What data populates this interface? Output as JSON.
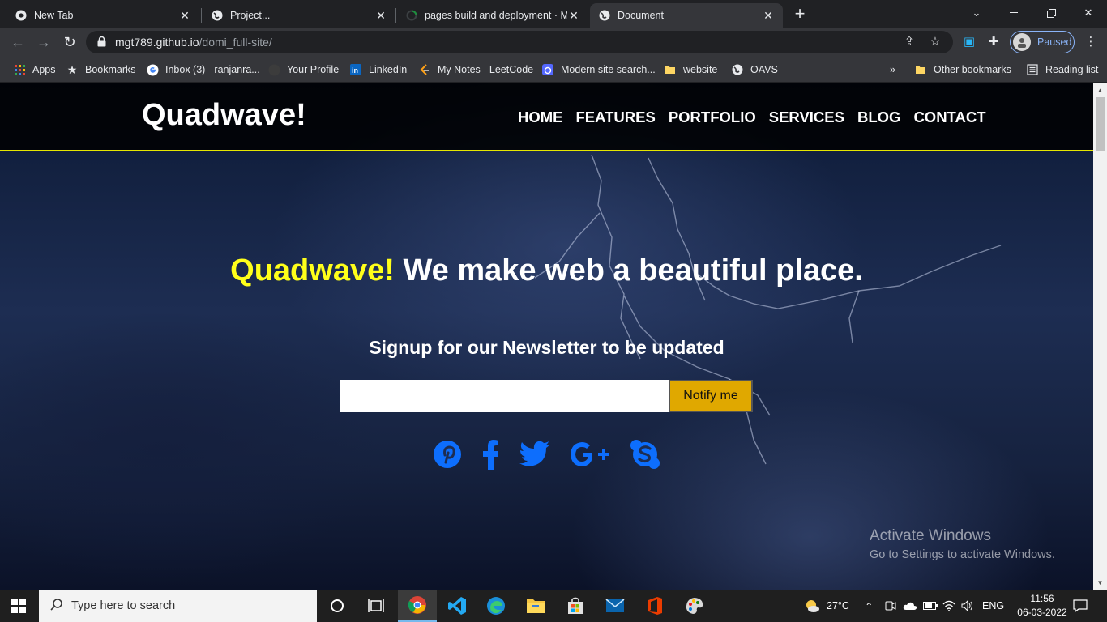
{
  "browser": {
    "tabs": [
      {
        "title": "New Tab",
        "active": false
      },
      {
        "title": "Project...",
        "active": false
      },
      {
        "title": "pages build and deployment · Mo",
        "active": false
      },
      {
        "title": "Document",
        "active": true
      }
    ],
    "url_host": "mgt789.github.io",
    "url_path": "/domi_full-site/",
    "profile_status": "Paused",
    "bookmarks": [
      "Apps",
      "Bookmarks",
      "Inbox (3) - ranjanra...",
      "Your Profile",
      "LinkedIn",
      "My Notes - LeetCode",
      "Modern site search...",
      "website",
      "OAVS"
    ],
    "bookmarks_overflow": "»",
    "other_bookmarks": "Other bookmarks",
    "reading_list": "Reading list"
  },
  "site": {
    "logo": "Quadwave!",
    "nav": [
      "HOME",
      "FEATURES",
      "PORTFOLIO",
      "SERVICES",
      "BLOG",
      "CONTACT"
    ],
    "hero_brand": "Quadwave!",
    "hero_text": " We make web a beautiful place.",
    "subheading": "Signup for our Newsletter to be updated",
    "email_value": "",
    "notify_label": "Notify me",
    "social_icons": [
      "pinterest-icon",
      "facebook-icon",
      "twitter-icon",
      "google-plus-icon",
      "skype-icon"
    ],
    "social_color": "#0d6efd",
    "accent_color": "#ffff1a",
    "button_color": "#e0a800"
  },
  "watermark": {
    "line1": "Activate Windows",
    "line2": "Go to Settings to activate Windows."
  },
  "taskbar": {
    "search_placeholder": "Type here to search",
    "weather": "27°C",
    "language": "ENG",
    "time": "11:56",
    "date": "06-03-2022"
  }
}
